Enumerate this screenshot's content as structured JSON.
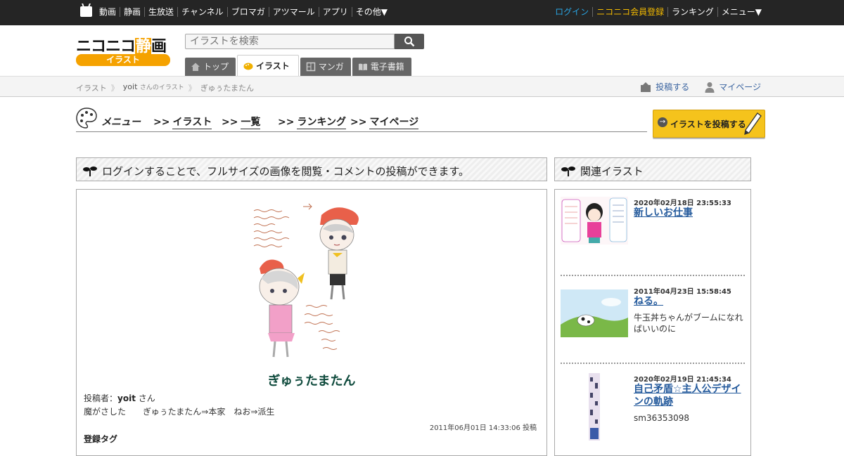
{
  "topnav": {
    "left": [
      "動画",
      "静画",
      "生放送",
      "チャンネル",
      "ブロマガ",
      "アツマール",
      "アプリ",
      "その他▼"
    ],
    "right": [
      "ログイン",
      "ニコニコ会員登録",
      "ランキング",
      "メニュー▼"
    ]
  },
  "logo": {
    "prefix": "ニコニコ",
    "highlight": "静",
    "suffix": "画",
    "pill": "イラスト"
  },
  "search": {
    "placeholder": "イラストを検索"
  },
  "tabs": [
    "トップ",
    "イラスト",
    "マンガ",
    "電子書籍"
  ],
  "breadcrumb": {
    "root": "イラスト",
    "user": "yoit",
    "user_suffix": "さんのイラスト",
    "current": "ぎゅぅたまたん"
  },
  "crumb_actions": {
    "post": "投稿する",
    "mypage": "マイページ"
  },
  "menu": {
    "label": "メニュー",
    "arrow": ">>",
    "links": [
      "イラスト",
      "一覧",
      "ランキング",
      "マイページ"
    ],
    "post_button": "イラストを投稿する"
  },
  "main": {
    "notice": "ログインすることで、フルサイズの画像を閲覧・コメントの投稿ができます。",
    "title": "ぎゅぅたまたん",
    "poster_label": "投稿者：",
    "poster_name": "yoit",
    "poster_suffix": " さん",
    "description": "魔がさした　　ぎゅぅたまたん⇒本家　ねお⇒派生",
    "posted_at": "2011年06月01日 14:33:06 投稿",
    "tags_label": "登録タグ"
  },
  "related": {
    "heading": "関連イラスト",
    "items": [
      {
        "date": "2020年02月18日 23:55:33",
        "title": "新しいお仕事",
        "sub": ""
      },
      {
        "date": "2011年04月23日 15:58:45",
        "title": "ねる。",
        "sub": "牛玉丼ちゃんがブームになればいいのに"
      },
      {
        "date": "2020年02月19日 21:45:34",
        "title": "自己矛盾☆主人公デザインの軌跡",
        "sub": "sm36353098"
      }
    ]
  },
  "colors": {
    "topbar": "#252525",
    "accent_orange": "#f5a200",
    "link_blue": "#245a9c",
    "post_button": "#f5c31c"
  }
}
